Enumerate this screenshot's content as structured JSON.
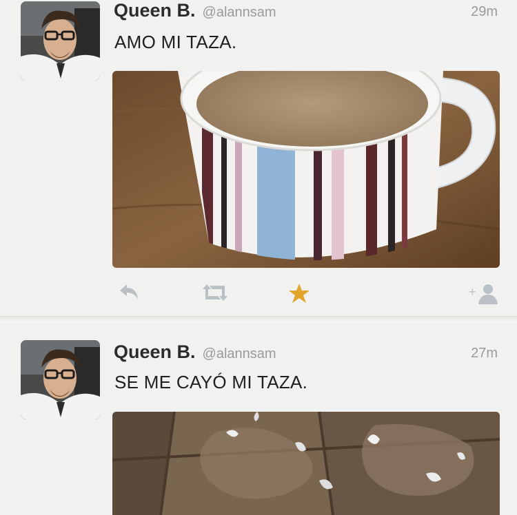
{
  "tweets": [
    {
      "name": "Queen B.",
      "handle": "@alannsam",
      "time": "29m",
      "text": "AMO MI TAZA.",
      "media": "mug-photo",
      "actions": [
        "reply-icon",
        "retweet-icon",
        "favorite-star-icon",
        "follow-icon"
      ],
      "favorited": true
    },
    {
      "name": "Queen B.",
      "handle": "@alannsam",
      "time": "27m",
      "text": "SE ME CAYÓ MI TAZA.",
      "media": "spilled-coffee-photo"
    }
  ],
  "colors": {
    "background": "#f1f1ef",
    "name": "#2c2c2c",
    "meta": "#9a9a9a",
    "favorite": "#e2a42a",
    "action": "#b9c0c6"
  }
}
